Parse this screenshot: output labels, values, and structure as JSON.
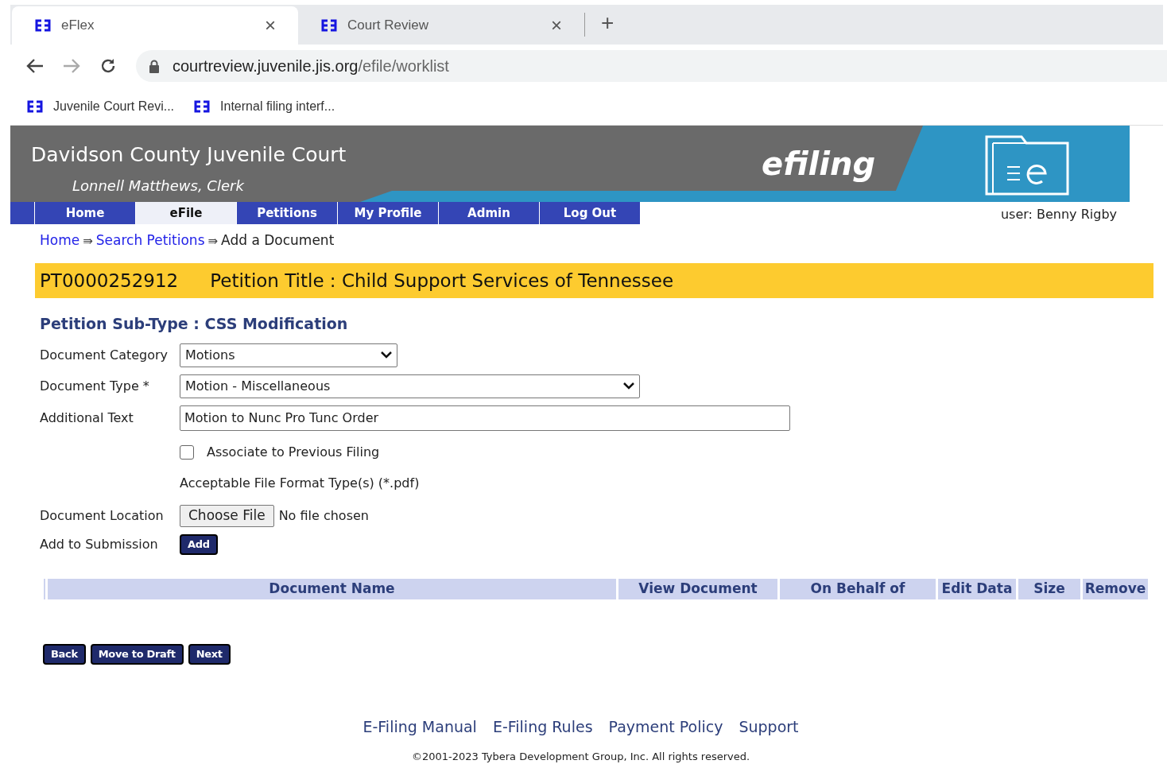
{
  "browser": {
    "tabs": [
      {
        "title": "eFlex",
        "close": "×",
        "selected": true
      },
      {
        "title": "Court Review",
        "close": "×",
        "selected": false
      }
    ],
    "new_tab": "+",
    "url": {
      "host": "courtreview.juvenile.jis.org",
      "path": "/efile/worklist"
    },
    "bookmarks": [
      "Juvenile Court Revi...",
      "Internal filing interf..."
    ]
  },
  "header": {
    "court": "Davidson County Juvenile Court",
    "clerk": "Lonnell Matthews, Clerk",
    "brand": "efiling"
  },
  "nav": [
    {
      "label": "Home",
      "selected": false
    },
    {
      "label": "eFile",
      "selected": true
    },
    {
      "label": "Petitions",
      "selected": false
    },
    {
      "label": "My Profile",
      "selected": false
    },
    {
      "label": "Admin",
      "selected": false
    },
    {
      "label": "Log Out",
      "selected": false
    }
  ],
  "user": "user: Benny Rigby",
  "breadcrumb": [
    {
      "label": "Home",
      "kind": "link"
    },
    {
      "label": "Search Petitions",
      "kind": "link"
    },
    {
      "label": "Add a Document",
      "kind": "current"
    }
  ],
  "breadcrumb_separator": "⇛",
  "petition": {
    "id": "PT0000252912",
    "title": "Petition Title : Child Support Services of Tennessee"
  },
  "subtype": "Petition Sub-Type : CSS Modification",
  "form": {
    "document_category": {
      "label": "Document Category",
      "value": "Motions"
    },
    "document_type": {
      "label": "Document Type *",
      "value": "Motion - Miscellaneous"
    },
    "additional_text": {
      "label": "Additional Text",
      "value": "Motion to Nunc Pro Tunc Order"
    },
    "associate": {
      "label": "Associate to Previous Filing",
      "checked": false
    },
    "format_note": "Acceptable File Format Type(s) (*.pdf)",
    "location": {
      "label": "Document Location",
      "button": "Choose File",
      "status": "No file chosen"
    },
    "add": {
      "label": "Add to Submission",
      "button": "Add"
    }
  },
  "table": {
    "columns": [
      "Document Name",
      "View Document",
      "On Behalf of",
      "Edit Data",
      "Size",
      "Remove"
    ]
  },
  "actions": [
    "Back",
    "Move to Draft",
    "Next"
  ],
  "footer": {
    "links": [
      "E-Filing Manual",
      "E-Filing Rules",
      "Payment Policy",
      "Support"
    ],
    "copyright": "©2001-2023 Tybera Development Group, Inc. All rights reserved."
  }
}
